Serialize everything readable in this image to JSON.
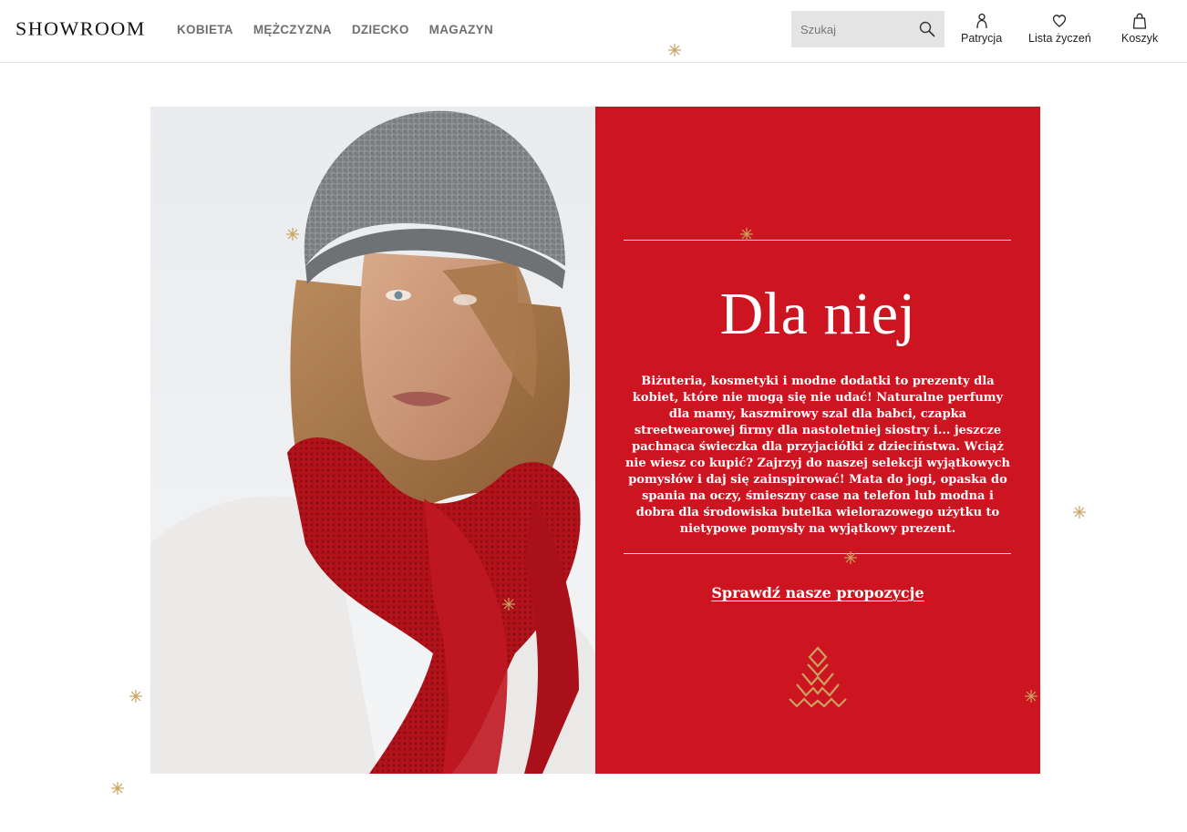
{
  "header": {
    "logo": "SHOWROOM",
    "nav": [
      {
        "label": "KOBIETA"
      },
      {
        "label": "MĘŻCZYZNA"
      },
      {
        "label": "DZIECKO"
      },
      {
        "label": "MAGAZYN"
      }
    ],
    "search": {
      "placeholder": "Szukaj",
      "value": ""
    },
    "actions": {
      "account": {
        "label": "Patrycja",
        "icon": "user-icon"
      },
      "wishlist": {
        "label": "Lista życzeń",
        "icon": "heart-icon"
      },
      "cart": {
        "label": "Koszyk",
        "icon": "shopping-bag-icon"
      }
    }
  },
  "banner": {
    "headline": "Dla niej",
    "description": "Biżuteria, kosmetyki i modne dodatki to prezenty dla kobiet, które nie mogą się nie udać! Naturalne perfumy dla mamy, kaszmirowy szal dla babci, czapka streetwearowej firmy dla nastoletniej siostry i... jeszcze pachnąca świeczka dla przyjaciółki z dzieciństwa. Wciąż nie wiesz co kupić? Zajrzyj do naszej selekcji wyjątkowych pomysłów i daj się zainspirować! Mata do jogi, opaska do spania na oczy, śmieszny case na telefon lub modna i dobra dla środowiska butelka wielorazowego użytku to nietypowe pomysły na wyjątkowy prezent.",
    "cta": "Sprawdź nasze propozycje",
    "photo": "woman-in-grey-beanie-and-red-scarf",
    "panel_color": "#cc1520",
    "accent_gold": "#c8a25e"
  }
}
